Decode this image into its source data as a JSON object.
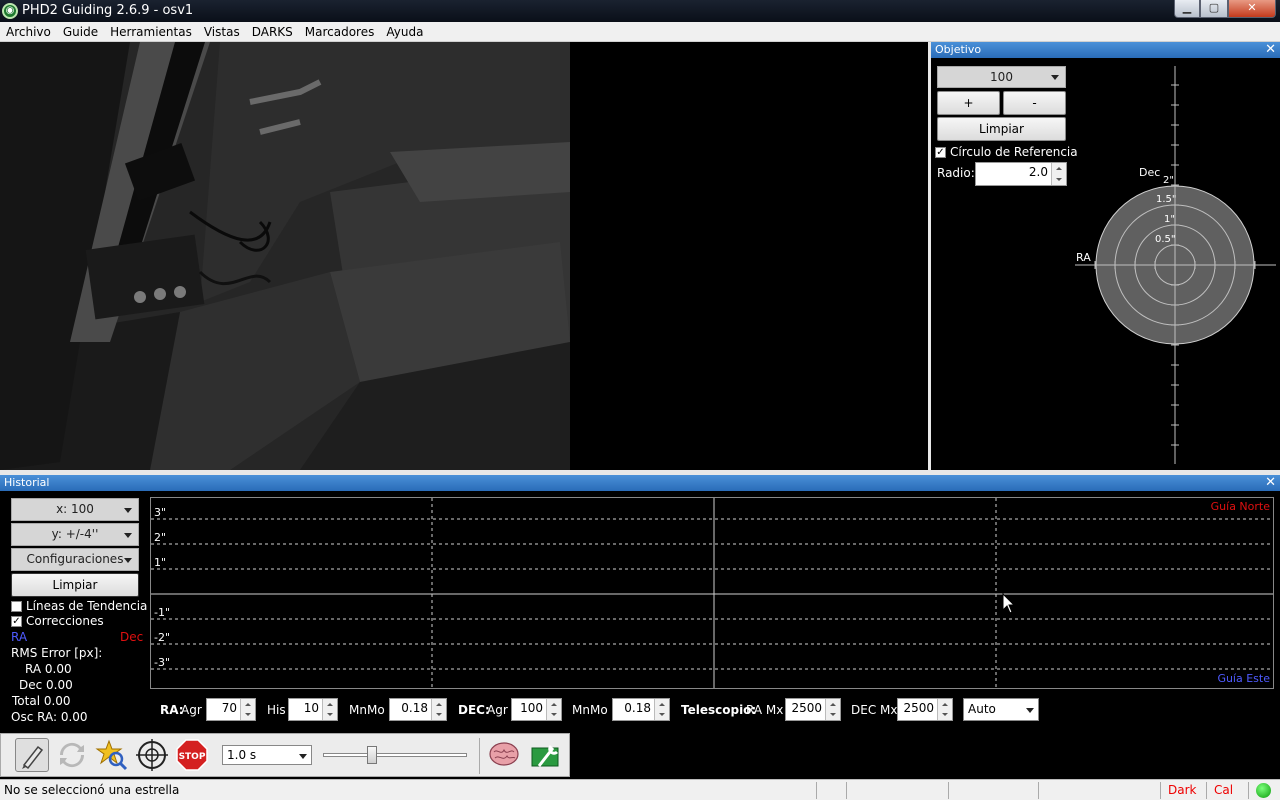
{
  "window": {
    "title": "PHD2 Guiding 2.6.9 - osv1",
    "minimize_glyph": "▁",
    "maximize_glyph": "▢",
    "close_glyph": "✕"
  },
  "menu": {
    "items": [
      "Archivo",
      "Guide",
      "Herramientas",
      "Vistas",
      "DARKS",
      "Marcadores",
      "Ayuda"
    ]
  },
  "objetivo": {
    "title": "Objetivo",
    "close_glyph": "✕",
    "zoom_value": "100",
    "plus_label": "+",
    "minus_label": "-",
    "clear_label": "Limpiar",
    "ref_circle_checked": true,
    "ref_circle_label": "Círculo de Referencia",
    "radius_label": "Radio:",
    "radius_value": "2.0",
    "dec_label": "Dec",
    "ra_label": "RA",
    "ring_labels": [
      "2\"",
      "1.5\"",
      "1\"",
      "0.5\""
    ]
  },
  "historial": {
    "title": "Historial",
    "close_glyph": "✕",
    "x_scale": "x: 100",
    "y_scale": "y: +/-4''",
    "settings_label": "Configuraciones",
    "clear_label": "Limpiar",
    "trend_lines_checked": false,
    "trend_lines_label": "Líneas de Tendencia",
    "corrections_checked": true,
    "corrections_label": "Correcciones",
    "ra_legend": "RA",
    "dec_legend": "Dec",
    "rms_title": "RMS Error [px]:",
    "rms_ra": "RA 0.00",
    "rms_dec": "Dec 0.00",
    "rms_total": "Total 0.00",
    "osc_ra": "Osc RA: 0.00",
    "y_axis_labels": [
      "3\"",
      "2\"",
      "1\"",
      "-1\"",
      "-2\"",
      "-3\""
    ],
    "guide_north": "Guía Norte",
    "guide_east": "Guía Este",
    "colors": {
      "ra": "#4f5bff",
      "dec": "#e01010"
    }
  },
  "params": {
    "ra_title": "RA:",
    "ra_agr_label": "Agr",
    "ra_agr_value": "70",
    "ra_his_label": "His",
    "ra_his_value": "10",
    "ra_mnmo_label": "MnMo",
    "ra_mnmo_value": "0.18",
    "dec_title": "DEC:",
    "dec_agr_label": "Agr",
    "dec_agr_value": "100",
    "dec_mnmo_label": "MnMo",
    "dec_mnmo_value": "0.18",
    "scope_title": "Telescopio:",
    "ra_mx_label": "RA Mx",
    "ra_mx_value": "2500",
    "dec_mx_label": "DEC Mx",
    "dec_mx_value": "2500",
    "mode_value": "Auto"
  },
  "toolbar": {
    "exposure_value": "1.0 s",
    "exposure_slider_fraction": 0.33,
    "stop_label": "STOP"
  },
  "statusbar": {
    "message": "No se seleccionó una estrella",
    "dark": "Dark",
    "cal": "Cal"
  }
}
